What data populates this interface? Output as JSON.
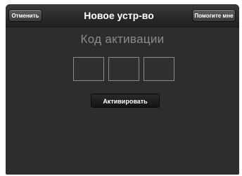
{
  "navbar": {
    "title": "Новое устр-во",
    "cancel_label": "Отменить",
    "help_label": "Помогите мне"
  },
  "main": {
    "heading": "Код активации",
    "code_fields": [
      "",
      "",
      ""
    ],
    "activate_label": "Активировать"
  },
  "colors": {
    "background": "#2d2d2d",
    "navbar": "#2a2a2a",
    "heading_text": "#8c8c8c",
    "field_border": "#8a8a8a"
  }
}
